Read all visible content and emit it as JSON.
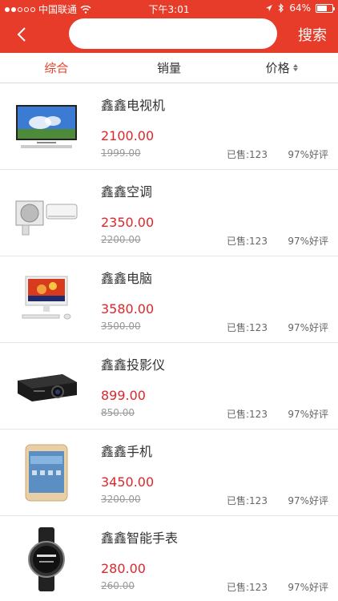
{
  "status_bar": {
    "carrier": "中国联通",
    "time": "下午3:01",
    "battery_percent": "64%",
    "battery_level": 0.64
  },
  "nav": {
    "search_value": "",
    "search_button": "搜索",
    "back_icon": "chevron-left-icon"
  },
  "tabs": [
    {
      "label": "综合",
      "active": true
    },
    {
      "label": "销量",
      "active": false
    },
    {
      "label": "价格",
      "active": false,
      "icon": "sort-icon"
    }
  ],
  "products": [
    {
      "name": "鑫鑫电视机",
      "price": "2100.00",
      "old_price": "1999.00",
      "sold": "已售:123",
      "rating": "97%好评",
      "image": "tv"
    },
    {
      "name": "鑫鑫空调",
      "price": "2350.00",
      "old_price": "2200.00",
      "sold": "已售:123",
      "rating": "97%好评",
      "image": "air-conditioner"
    },
    {
      "name": "鑫鑫电脑",
      "price": "3580.00",
      "old_price": "3500.00",
      "sold": "已售:123",
      "rating": "97%好评",
      "image": "computer"
    },
    {
      "name": "鑫鑫投影仪",
      "price": "899.00",
      "old_price": "850.00",
      "sold": "已售:123",
      "rating": "97%好评",
      "image": "projector"
    },
    {
      "name": "鑫鑫手机",
      "price": "3450.00",
      "old_price": "3200.00",
      "sold": "已售:123",
      "rating": "97%好评",
      "image": "phone"
    },
    {
      "name": "鑫鑫智能手表",
      "price": "280.00",
      "old_price": "260.00",
      "sold": "已售:123",
      "rating": "97%好评",
      "image": "smartwatch"
    }
  ],
  "colors": {
    "brand": "#e83c2a",
    "price": "#e0262b"
  }
}
